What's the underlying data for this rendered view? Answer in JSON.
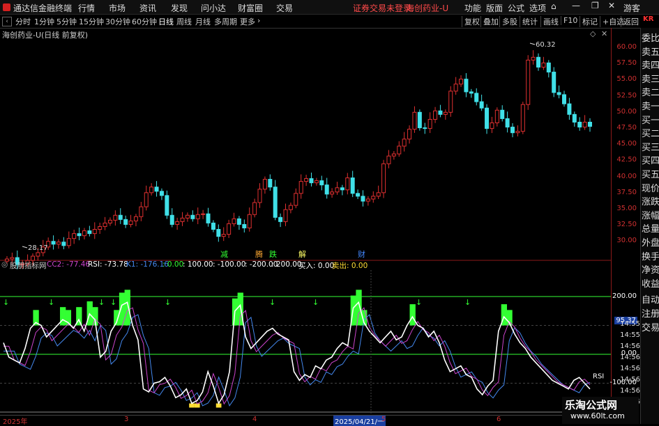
{
  "app": {
    "title": "通达信金融终端",
    "menu": [
      "行情",
      "市场",
      "资讯",
      "发现",
      "问小达",
      "财富圈",
      "交易"
    ],
    "login_notice": "证券交易未登录",
    "stock_label": "海创药业-U",
    "right_menu": [
      "功能",
      "版面",
      "公式",
      "选项"
    ],
    "guest": "游客"
  },
  "period_bar": {
    "periods": [
      "分时",
      "1分钟",
      "5分钟",
      "15分钟",
      "30分钟",
      "60分钟",
      "日线",
      "周线",
      "月线",
      "多周期",
      "更多"
    ],
    "active": "日线",
    "tools": [
      "复权",
      "叠加",
      "多股",
      "统计",
      "画线",
      "F10",
      "标记",
      "+自选",
      "返回"
    ]
  },
  "main_chart": {
    "title": "海创药业-U(日线 前复权)",
    "price_ticks": [
      "60.00",
      "57.50",
      "55.00",
      "52.50",
      "50.00",
      "47.50",
      "45.00",
      "42.50",
      "40.00",
      "37.50",
      "35.00",
      "32.50",
      "30.00"
    ],
    "high_label": "60.32",
    "low_label": "28.17",
    "events": [
      "减",
      "腾",
      "跌",
      "解",
      "财"
    ]
  },
  "indicator": {
    "name": "股朋指标网",
    "cc2": "CC2: -77.46",
    "rsi": "RSI: -73.78",
    "k1": "K1: -176.16",
    "lines": [
      ": 0.00",
      ": 100.00",
      ": -100.00",
      ": -200.00",
      ": 200.00"
    ],
    "buy": "买入: 0.00",
    "sell": "卖出: 0.00",
    "axis_ticks": [
      "200.00",
      "0.00",
      "-100.00"
    ],
    "current_value": "95.37",
    "rsi_tag": "RSI",
    "times": [
      "14:55",
      "14:55",
      "14:56",
      "14:56",
      "14:56",
      "14:56",
      "14:56",
      "14:56"
    ]
  },
  "right_panel": {
    "items": [
      "委比",
      "卖五",
      "卖四",
      "卖三",
      "卖二",
      "卖一",
      "买一",
      "买二",
      "买三",
      "买四",
      "买五",
      "现价",
      "涨跌",
      "涨幅",
      "总量",
      "外盘",
      "换手",
      "净资",
      "收益",
      "自动",
      "注册",
      "交易"
    ],
    "corner": "KR"
  },
  "date_axis": {
    "labels": [
      "2025年",
      "3",
      "4",
      "2025/04/21/一",
      "5",
      "6"
    ]
  },
  "watermark": {
    "title": "乐淘公式网",
    "url": "www.60lt.com"
  },
  "colors": {
    "up": "#e03030",
    "down": "#40e0e8",
    "fill": "#33ff33",
    "rsi_line": "#ffffff",
    "cc2_line": "#cc44cc",
    "k1_line": "#4488ee",
    "accent": "#ff3030"
  }
}
